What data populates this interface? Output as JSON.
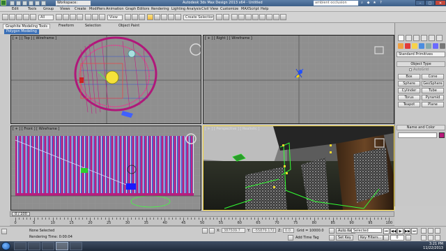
{
  "titlebar": {
    "workspace": "Workspace: Default",
    "app_title": "Autodesk 3ds Max Design 2013 x64 - Untitled",
    "search_placeholder": "ambient occlusion",
    "minimize": "–",
    "maximize": "□",
    "close": "✕"
  },
  "menubar": {
    "items": [
      "Edit",
      "Tools",
      "Group",
      "Views",
      "Create",
      "Modifiers",
      "Animation",
      "Graph Editors",
      "Rendering",
      "Lighting Analysis",
      "Civil View",
      "Customize",
      "MAXScript",
      "Help"
    ]
  },
  "toolbar": {
    "filter_value": "All",
    "view_value": "View",
    "selection_set_placeholder": "Create Selection Set"
  },
  "ribbon": {
    "tabs": [
      "Graphite Modeling Tools",
      "Freeform",
      "Selection",
      "Object Paint"
    ],
    "active_sub": "Polygon Modeling"
  },
  "viewports": {
    "top": "[ + ] [ Top ] [ Wireframe ]",
    "right": "[ + ] [ Right ] [ Wireframe ]",
    "front": "[ + ] [ Front ] [ Wireframe ]",
    "perspective": "[ + ] [ Perspective ] [ Realistic ]"
  },
  "command_panel": {
    "category": "Standard Primitives",
    "object_type_title": "Object Type",
    "autogrid": "AutoGrid",
    "objects": [
      "Box",
      "Cone",
      "Sphere",
      "GeoSphere",
      "Cylinder",
      "Tube",
      "Torus",
      "Pyramid",
      "Teapot",
      "Plane"
    ],
    "name_color_title": "Name and Color",
    "color_swatch": "#b8197a"
  },
  "timeline": {
    "frame_readout": "0 / 100",
    "ticks": [
      "0",
      "5",
      "10",
      "15",
      "20",
      "25",
      "30",
      "35",
      "40",
      "45",
      "50",
      "55",
      "60",
      "65",
      "70",
      "75",
      "80",
      "85",
      "90",
      "95",
      "100"
    ]
  },
  "status": {
    "selection": "None Selected",
    "rendering_time": "Rendering Time: 0:00:04",
    "x_label": "X:",
    "x_value": "387509.7",
    "y_label": "Y:",
    "y_value": "-55879.172",
    "z_label": "Z:",
    "z_value": "0.0",
    "grid": "Grid = 10000.0",
    "add_time_tag": "Add Time Tag",
    "auto_key": "Auto Key",
    "set_key": "Set Key",
    "selected_dropdown": "Selected",
    "key_filters": "Key Filters...",
    "current_frame": "0",
    "play_controls": [
      "⏮",
      "◀◀",
      "▶",
      "▶▶",
      "⏭"
    ]
  },
  "taskbar": {
    "time": "3:21 PM",
    "date": "11/22/2013"
  }
}
